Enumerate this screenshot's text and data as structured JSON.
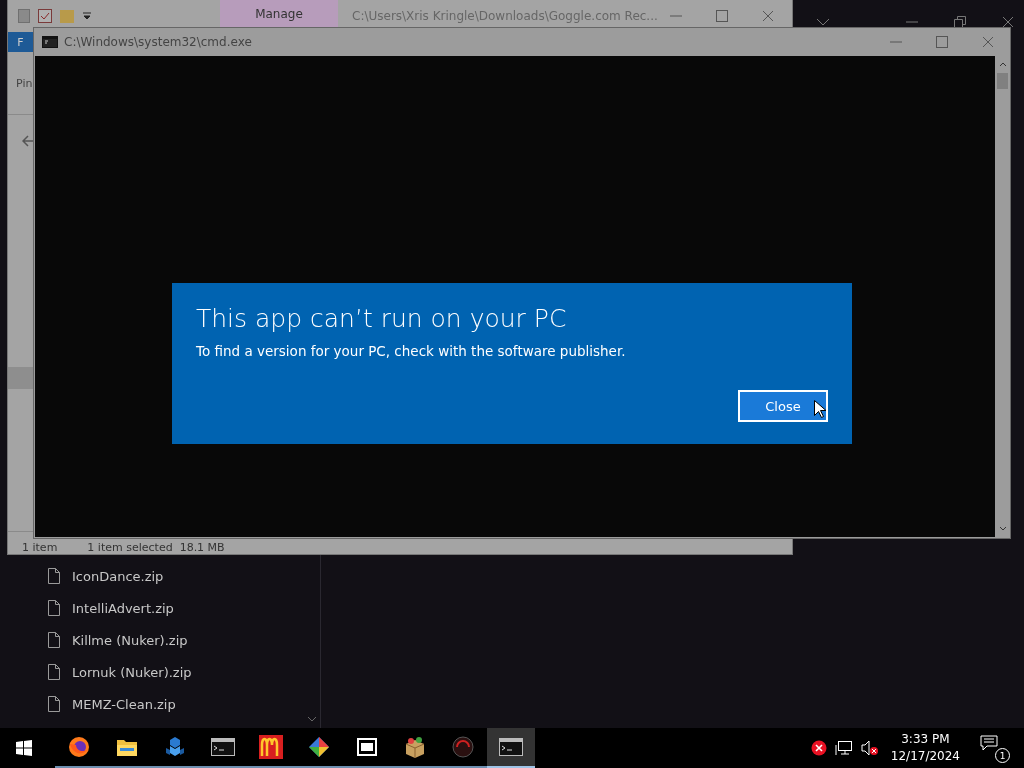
{
  "background_explorer": {
    "files": [
      {
        "name": "IconDance.zip"
      },
      {
        "name": "IntelliAdvert.zip"
      },
      {
        "name": "Killme (Nuker).zip"
      },
      {
        "name": "Lornuk (Nuker).zip"
      },
      {
        "name": "MEMZ-Clean.zip"
      }
    ]
  },
  "explorer": {
    "ribbon_tab": "Manage",
    "path": "C:\\Users\\Xris Kringle\\Downloads\\Goggle.com Rec...",
    "file_tab": "F",
    "pin_label": "Pin",
    "status_count": "1 item",
    "status_selected": "1 item selected  18.1 MB"
  },
  "console": {
    "title": "C:\\Windows\\system32\\cmd.exe"
  },
  "dialog": {
    "title": "This app can’t run on your PC",
    "message": "To find a version for your PC, check with the software publisher.",
    "button": "Close"
  },
  "taskbar": {
    "apps": [
      {
        "kind": "firefox",
        "running": true,
        "active": false
      },
      {
        "kind": "folder",
        "running": true,
        "active": false
      },
      {
        "kind": "cubes",
        "running": true,
        "active": false
      },
      {
        "kind": "console",
        "running": true,
        "active": false
      },
      {
        "kind": "arches",
        "running": true,
        "active": false
      },
      {
        "kind": "diamond",
        "running": true,
        "active": false
      },
      {
        "kind": "sevenzip",
        "running": true,
        "active": false
      },
      {
        "kind": "package",
        "running": true,
        "active": false
      },
      {
        "kind": "disc",
        "running": true,
        "active": false
      },
      {
        "kind": "console",
        "running": true,
        "active": true
      }
    ],
    "time": "3:33 PM",
    "date": "12/17/2024",
    "notification_count": "1"
  }
}
